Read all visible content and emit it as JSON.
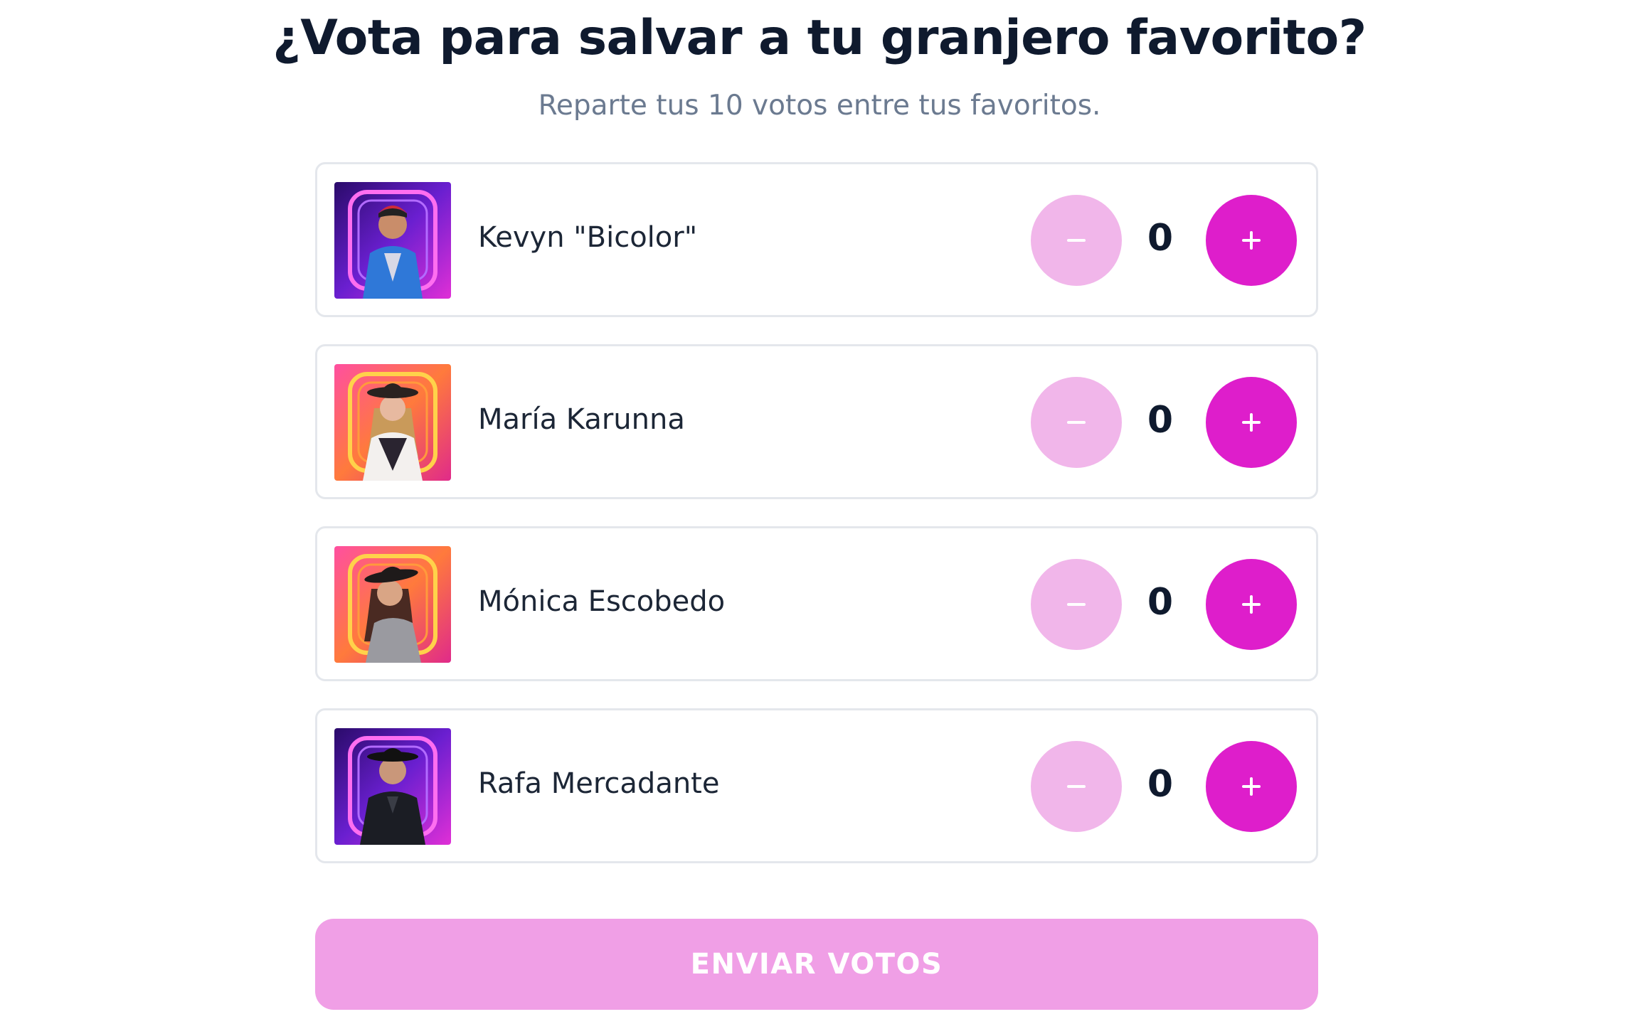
{
  "header": {
    "title": "¿Vota para salvar a tu granjero favorito?",
    "subtitle": "Reparte tus 10 votos entre tus favoritos."
  },
  "contestants": [
    {
      "name": "Kevyn \"Bicolor\"",
      "votes": "0",
      "theme": "purple",
      "outfit": "#2f78d8"
    },
    {
      "name": "María Karunna",
      "votes": "0",
      "theme": "pink",
      "outfit": "#2a2430"
    },
    {
      "name": "Mónica Escobedo",
      "votes": "0",
      "theme": "pink",
      "outfit": "#9a9aa0"
    },
    {
      "name": "Rafa Mercadante",
      "votes": "0",
      "theme": "purple",
      "outfit": "#1b1d24"
    }
  ],
  "controls": {
    "minus_icon": "minus-icon",
    "plus_icon": "plus-icon"
  },
  "submit": {
    "label": "ENVIAR VOTOS"
  },
  "colors": {
    "accent": "#de1ecb",
    "accent_disabled": "#f1b6ea",
    "submit_disabled": "#f09fe6",
    "title": "#0f1a2e",
    "subtitle": "#6b7a90",
    "card_border": "#e4e7ec"
  }
}
